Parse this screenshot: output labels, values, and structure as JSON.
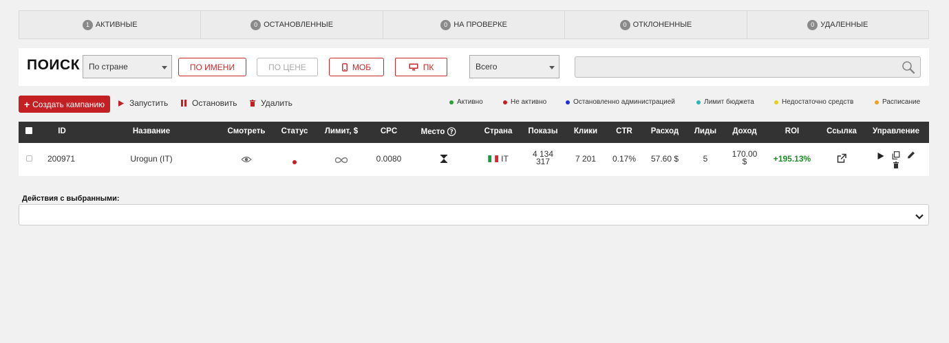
{
  "tabs": [
    {
      "count": "1",
      "label": "АКТИВНЫЕ"
    },
    {
      "count": "0",
      "label": "ОСТАНОВЛЕННЫЕ"
    },
    {
      "count": "0",
      "label": "НА ПРОВЕРКЕ"
    },
    {
      "count": "0",
      "label": "ОТКЛОНЕННЫЕ"
    },
    {
      "count": "0",
      "label": "УДАЛЕННЫЕ"
    }
  ],
  "search": {
    "title": "ПОИСК",
    "country_select": "По стране",
    "by_name": "ПО ИМЕНИ",
    "by_price": "ПО ЦЕНЕ",
    "mob": "МОБ",
    "pc": "ПК",
    "scope_select": "Всего",
    "input_value": ""
  },
  "actions": {
    "create": "Создать кампанию",
    "start": "Запустить",
    "stop": "Остановить",
    "delete": "Удалить"
  },
  "legend": [
    {
      "label": "Активно",
      "color": "#2ba13a"
    },
    {
      "label": "Не активно",
      "color": "#c41f23"
    },
    {
      "label": "Остановленно администрацией",
      "color": "#1f2ed6"
    },
    {
      "label": "Лимит бюджета",
      "color": "#29b7b5"
    },
    {
      "label": "Недостаточно средств",
      "color": "#e4d21c"
    },
    {
      "label": "Расписание",
      "color": "#f0a020"
    }
  ],
  "table": {
    "headers": {
      "id": "ID",
      "name": "Название",
      "view": "Смотреть",
      "status": "Статус",
      "limit": "Лимит, $",
      "cpc": "CPC",
      "place": "Место",
      "country": "Страна",
      "impressions": "Показы",
      "clicks": "Клики",
      "ctr": "CTR",
      "spend": "Расход",
      "leads": "Лиды",
      "income": "Доход",
      "roi": "ROI",
      "link": "Ссылка",
      "manage": "Управление"
    },
    "rows": [
      {
        "id": "200971",
        "name": "Urogun (IT)",
        "status_color": "#c41f23",
        "cpc": "0.0080",
        "country": "IT",
        "impressions_1": "4 134",
        "impressions_2": "317",
        "clicks": "7 201",
        "ctr": "0.17%",
        "spend": "57.60 $",
        "leads": "5",
        "income_1": "170.00",
        "income_2": "$",
        "roi": "+195.13%"
      }
    ]
  },
  "bulk": {
    "label": "Действия с выбранными:",
    "value": ""
  }
}
